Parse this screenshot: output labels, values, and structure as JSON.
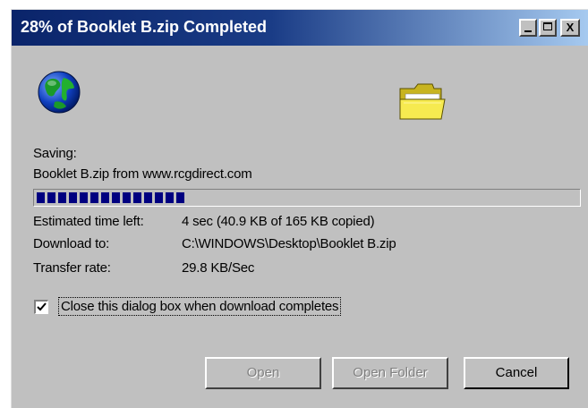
{
  "window": {
    "title": "28% of Booklet B.zip Completed"
  },
  "titlebar_buttons": {
    "close_glyph": "X"
  },
  "status": {
    "saving_label": "Saving:",
    "saving_value": "Booklet B.zip from www.rcgdirect.com"
  },
  "progress": {
    "percent": 28,
    "fill_color": "#000080"
  },
  "details": {
    "time_left_label": "Estimated time left:",
    "time_left_value": "4 sec (40.9 KB of 165 KB copied)",
    "download_to_label": "Download to:",
    "download_to_value": "C:\\WINDOWS\\Desktop\\Booklet B.zip",
    "transfer_rate_label": "Transfer rate:",
    "transfer_rate_value": "29.8 KB/Sec"
  },
  "options": {
    "close_when_done_label": "Close this dialog box when download completes",
    "close_when_done_checked": true
  },
  "buttons": {
    "open_label": "Open",
    "open_folder_label": "Open Folder",
    "cancel_label": "Cancel"
  },
  "icons": {
    "globe": "globe-icon",
    "folder": "folder-icon"
  },
  "colors": {
    "titlebar_start": "#0a246a",
    "titlebar_end": "#a6caf0",
    "dialog_bg": "#c0c0c0"
  }
}
